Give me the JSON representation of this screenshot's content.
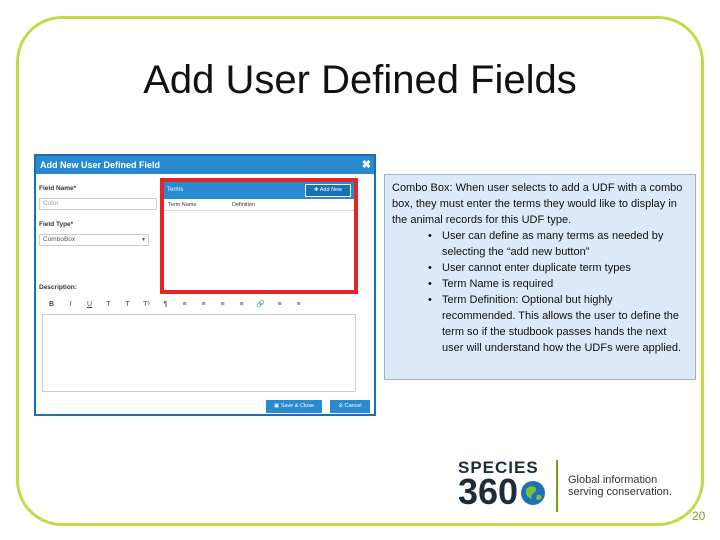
{
  "slide": {
    "title": "Add User Defined Fields",
    "page_number": "20"
  },
  "dialog": {
    "title": "Add New User Defined Field",
    "field_name_label": "Field Name*",
    "field_name_value": "Color",
    "field_type_label": "Field Type*",
    "field_type_value": "ComboBox",
    "description_label": "Description:",
    "terms": {
      "title": "Terms",
      "add_button": "Add New",
      "col_term_name": "Term Name",
      "col_definition": "Definition"
    },
    "toolbar": [
      "B",
      "I",
      "U",
      "T",
      "T",
      "Tˢ",
      "¶",
      "≡",
      "≡",
      "≡",
      "≡",
      "🔗",
      "≡",
      "≡"
    ],
    "save_button": "Save & Close",
    "cancel_button": "Cancel"
  },
  "info": {
    "intro_label": "Combo Box:",
    "intro_text": " When user selects to add a UDF with a combo box, they must enter the terms they would like to display in the animal records for this UDF type.",
    "bullets": [
      "User can define as many terms as needed by selecting the “add new button”",
      "User cannot enter duplicate term types",
      "Term Name is required",
      "Term Definition: Optional but highly recommended. This allows the user to define the term so if the studbook passes hands the next user will understand how the UDFs were applied."
    ]
  },
  "logo": {
    "line1": "SPECIES",
    "line2": "360",
    "tagline1": "Global information",
    "tagline2": "serving conservation."
  },
  "colors": {
    "frame": "#c6d84a",
    "dialog_blue": "#2a8ad0",
    "highlight_red": "#e32526",
    "info_bg": "#dce9f8"
  }
}
